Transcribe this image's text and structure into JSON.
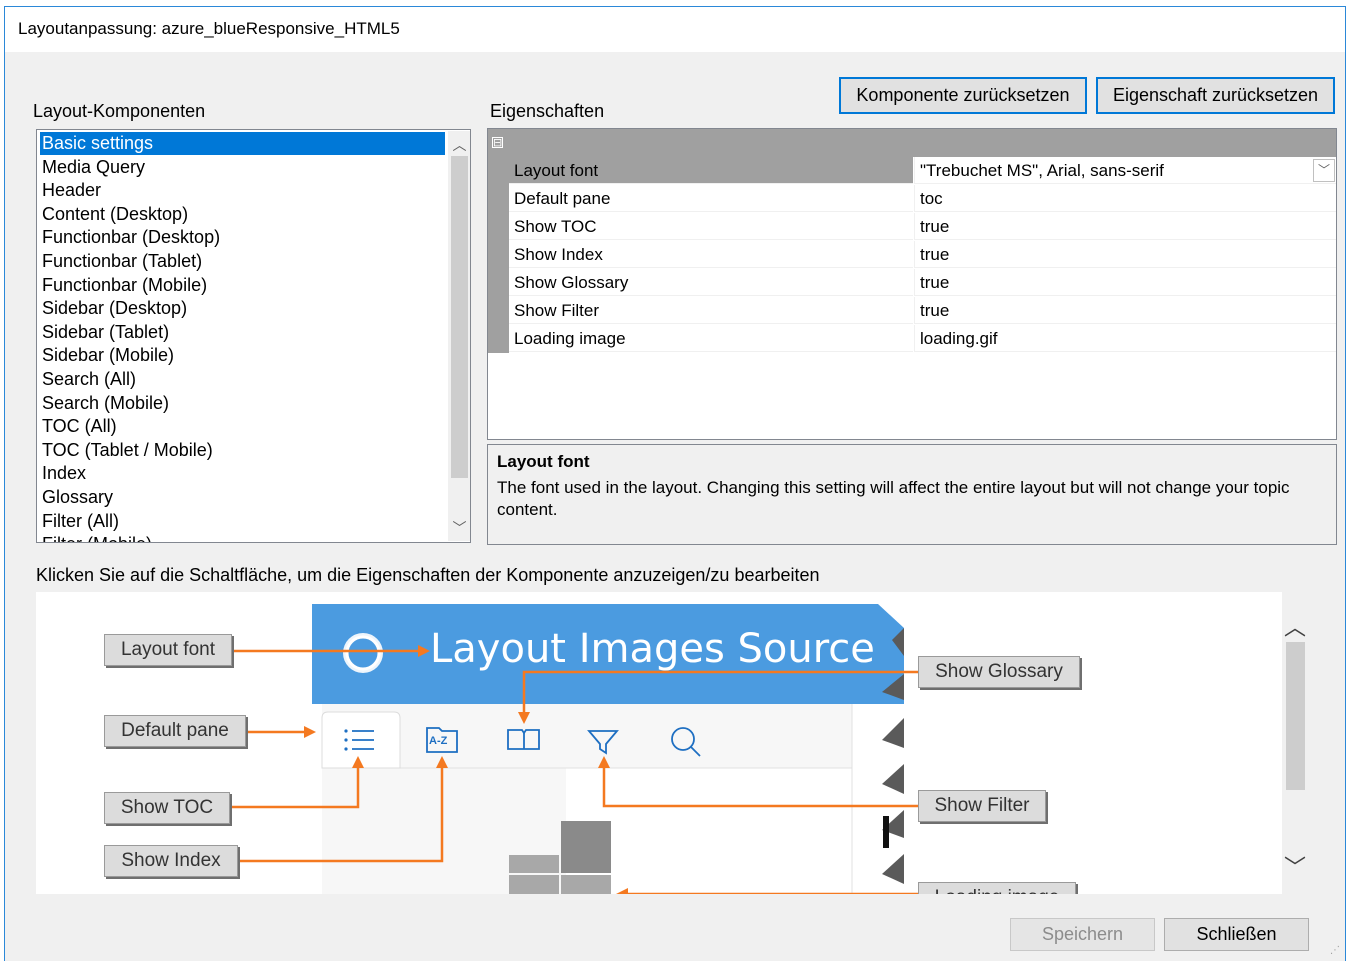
{
  "window": {
    "title": "Layoutanpassung: azure_blueResponsive_HTML5"
  },
  "components": {
    "label": "Layout-Komponenten",
    "items": [
      "Basic settings",
      "Media Query",
      "Header",
      "Content (Desktop)",
      "Functionbar (Desktop)",
      "Functionbar (Tablet)",
      "Functionbar (Mobile)",
      "Sidebar (Desktop)",
      "Sidebar (Tablet)",
      "Sidebar (Mobile)",
      "Search (All)",
      "Search (Mobile)",
      "TOC (All)",
      "TOC (Tablet / Mobile)",
      "Index",
      "Glossary",
      "Filter (All)",
      "Filter (Mobile)"
    ],
    "selected_index": 0
  },
  "toolbar": {
    "reset_component": "Komponente zurücksetzen",
    "reset_property": "Eigenschaft zurücksetzen"
  },
  "properties": {
    "label": "Eigenschaften",
    "collapse_glyph": "⊟",
    "rows": [
      {
        "name": "Layout font",
        "value": "\"Trebuchet MS\", Arial, sans-serif"
      },
      {
        "name": "Default pane",
        "value": "toc"
      },
      {
        "name": "Show TOC",
        "value": "true"
      },
      {
        "name": "Show Index",
        "value": "true"
      },
      {
        "name": "Show Glossary",
        "value": "true"
      },
      {
        "name": "Show Filter",
        "value": "true"
      },
      {
        "name": "Loading image",
        "value": "loading.gif"
      }
    ],
    "selected_index": 0
  },
  "description": {
    "title": "Layout font",
    "text": "The font used in the layout. Changing this setting will affect the entire layout but will not change your topic content."
  },
  "hint": "Klicken Sie auf die Schaltfläche, um die Eigenschaften der Komponente anzuzeigen/zu bearbeiten",
  "preview": {
    "header_title": "Layout Images Source",
    "az_label": "A-Z",
    "callouts": {
      "layout_font": "Layout font",
      "default_pane": "Default pane",
      "show_toc": "Show TOC",
      "show_index": "Show Index",
      "show_glossary": "Show Glossary",
      "show_filter": "Show Filter",
      "loading_image": "Loading image"
    },
    "colors": {
      "header": "#4b9be0",
      "arrow": "#f47920",
      "icon": "#1e6fc2"
    }
  },
  "footer": {
    "save": "Speichern",
    "close": "Schließen"
  }
}
